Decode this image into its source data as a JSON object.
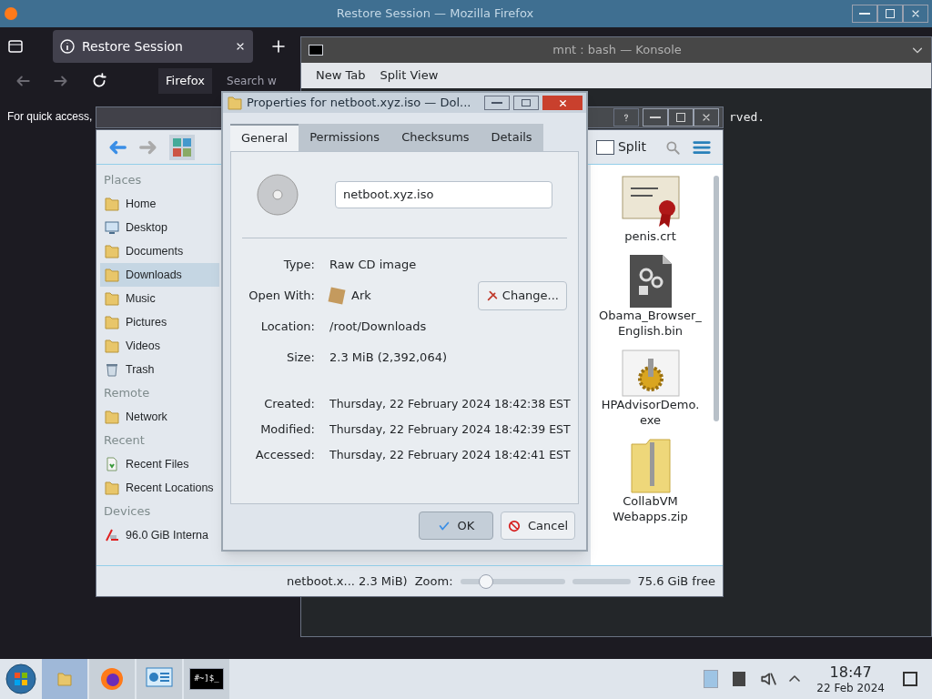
{
  "firefox": {
    "title": "Restore Session — Mozilla Firefox",
    "tabs": [
      {
        "label": "Restore Session",
        "selected": true
      }
    ],
    "identity": "Firefox",
    "search_placeholder": "Search w",
    "bookmarks_hint": "For quick access,"
  },
  "konsole": {
    "title": "mnt : bash — Konsole",
    "toolbar": [
      "New Tab",
      "Split View"
    ],
    "terminal_text": "rved."
  },
  "dolphin": {
    "split_label": "Split",
    "places": [
      {
        "section": "Places",
        "items": [
          {
            "label": "Home",
            "kind": "folder",
            "selected": false
          },
          {
            "label": "Desktop",
            "kind": "desktop",
            "selected": false
          },
          {
            "label": "Documents",
            "kind": "folder",
            "selected": false
          },
          {
            "label": "Downloads",
            "kind": "folder",
            "selected": true
          },
          {
            "label": "Music",
            "kind": "folder",
            "selected": false
          },
          {
            "label": "Pictures",
            "kind": "folder",
            "selected": false
          },
          {
            "label": "Videos",
            "kind": "folder",
            "selected": false
          },
          {
            "label": "Trash",
            "kind": "trash",
            "selected": false
          }
        ]
      },
      {
        "section": "Remote",
        "items": [
          {
            "label": "Network",
            "kind": "folder",
            "selected": false
          }
        ]
      },
      {
        "section": "Recent",
        "items": [
          {
            "label": "Recent Files",
            "kind": "recent",
            "selected": false
          },
          {
            "label": "Recent Locations",
            "kind": "folder",
            "selected": false
          }
        ]
      },
      {
        "section": "Devices",
        "items": [
          {
            "label": "96.0 GiB Interna",
            "kind": "drive",
            "selected": false
          }
        ]
      }
    ],
    "files": [
      {
        "name": "penis.crt",
        "kind": "certificate"
      },
      {
        "name": "Obama_Browser_ English.bin",
        "kind": "binary"
      },
      {
        "name": "HPAdvisorDemo. exe",
        "kind": "executable"
      },
      {
        "name": "CollabVM Webapps.zip",
        "kind": "archive"
      }
    ],
    "status": {
      "selection": "netboot.x... 2.3 MiB)",
      "zoom_label": "Zoom:",
      "zoom": {
        "level": 0.25
      },
      "free": "75.6 GiB free"
    }
  },
  "dialog": {
    "title": "Properties for netboot.xyz.iso — Dol...",
    "tabs": [
      {
        "label": "General",
        "selected": true
      },
      {
        "label": "Permissions",
        "selected": false
      },
      {
        "label": "Checksums",
        "selected": false
      },
      {
        "label": "Details",
        "selected": false
      }
    ],
    "name_value": "netboot.xyz.iso",
    "rows": [
      {
        "label": "Type:",
        "value": "Raw CD image"
      },
      {
        "label": "Open With:",
        "value": "Ark",
        "app": true,
        "button": "Change..."
      },
      {
        "label": "Location:",
        "value": "/root/Downloads"
      },
      {
        "label": "Size:",
        "value": "2.3 MiB (2,392,064)"
      }
    ],
    "date_rows": [
      {
        "label": "Created:",
        "value": "Thursday, 22 February 2024 18:42:38 EST"
      },
      {
        "label": "Modified:",
        "value": "Thursday, 22 February 2024 18:42:39 EST"
      },
      {
        "label": "Accessed:",
        "value": "Thursday, 22 February 2024 18:42:41 EST"
      }
    ],
    "ok": "OK",
    "cancel": "Cancel"
  },
  "taskbar": {
    "tasks": [
      {
        "kind": "files",
        "selected": true
      },
      {
        "kind": "browser",
        "selected": false
      },
      {
        "kind": "settings",
        "selected": false
      },
      {
        "kind": "terminal",
        "selected": false,
        "label": "#~]$_"
      }
    ],
    "time": "18:47",
    "date": "22 Feb 2024"
  }
}
